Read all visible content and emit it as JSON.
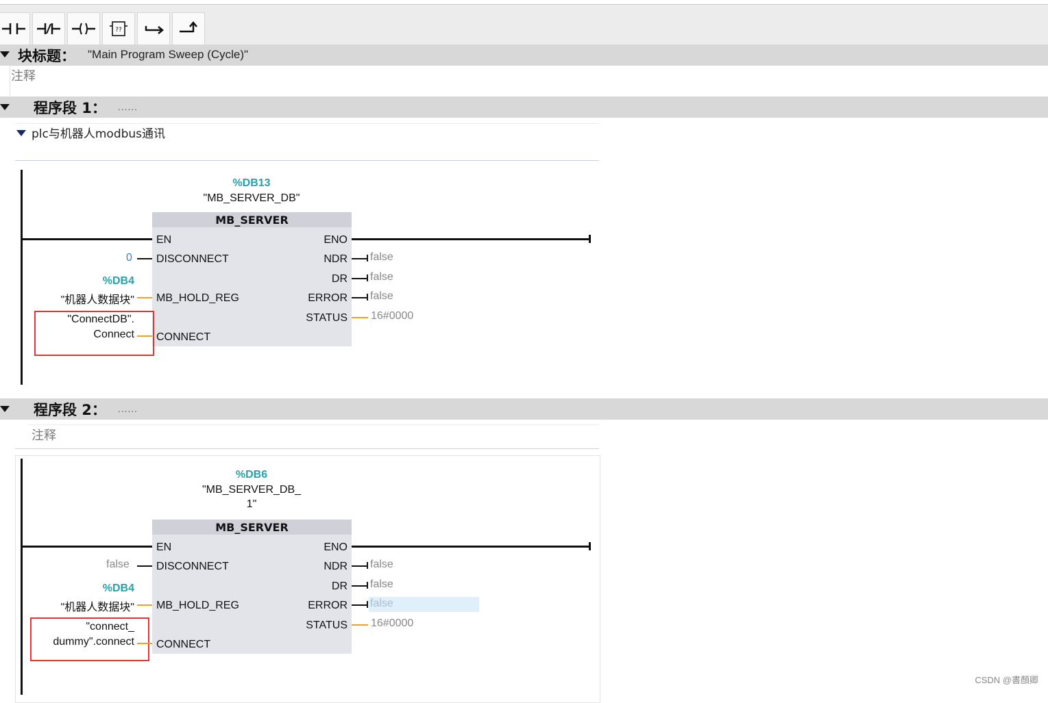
{
  "toolbar": {
    "buttons": [
      {
        "name": "normally-open-contact-icon"
      },
      {
        "name": "normally-closed-contact-icon"
      },
      {
        "name": "output-coil-icon"
      },
      {
        "name": "empty-box-icon",
        "glyph": "??"
      },
      {
        "name": "open-branch-icon"
      },
      {
        "name": "close-branch-icon"
      }
    ]
  },
  "block_header": {
    "label": "块标题：",
    "title": "\"Main Program Sweep (Cycle)\"",
    "comment": "注释"
  },
  "networks": [
    {
      "label": "程序段 1：",
      "dots": "......",
      "comment": "plc与机器人modbus通讯",
      "db_number": "%DB13",
      "db_name_line1": "\"MB_SERVER_DB\"",
      "db_name_line2": "",
      "block_name": "MB_SERVER",
      "inputs": {
        "en": "EN",
        "disconnect": "DISCONNECT",
        "mb_hold_reg": "MB_HOLD_REG",
        "connect": "CONNECT"
      },
      "outputs": {
        "eno": "ENO",
        "ndr": "NDR",
        "dr": "DR",
        "error": "ERROR",
        "status": "STATUS"
      },
      "disconnect_value": "0",
      "hold_reg_db": "%DB4",
      "hold_reg_name": "\"机器人数据块\"",
      "connect_operand_line1": "\"ConnectDB\".",
      "connect_operand_line2": "Connect",
      "ndr_value": "false",
      "dr_value": "false",
      "error_value": "false",
      "status_value": "16#0000"
    },
    {
      "label": "程序段 2：",
      "dots": "......",
      "comment": "注释",
      "db_number": "%DB6",
      "db_name_line1": "\"MB_SERVER_DB_",
      "db_name_line2": "1\"",
      "block_name": "MB_SERVER",
      "inputs": {
        "en": "EN",
        "disconnect": "DISCONNECT",
        "mb_hold_reg": "MB_HOLD_REG",
        "connect": "CONNECT"
      },
      "outputs": {
        "eno": "ENO",
        "ndr": "NDR",
        "dr": "DR",
        "error": "ERROR",
        "status": "STATUS"
      },
      "disconnect_value": "false",
      "hold_reg_db": "%DB4",
      "hold_reg_name": "\"机器人数据块\"",
      "connect_operand_line1": "\"connect_",
      "connect_operand_line2": "dummy\".connect",
      "ndr_value": "false",
      "dr_value": "false",
      "error_value": "false",
      "status_value": "16#0000"
    }
  ],
  "colors": {
    "accent_teal": "#2aa0a8",
    "highlight_box": "#e53333",
    "wire_orange": "#f0a020"
  },
  "watermark": "CSDN @書顏卿"
}
